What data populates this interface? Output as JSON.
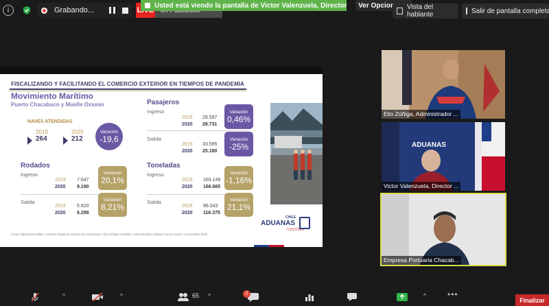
{
  "topbar": {
    "info_icon": "info-icon",
    "shield_icon": "shield-icon",
    "recording_label": "Grabando...",
    "live_label": "LIVE",
    "facebook_label": "en Facebook",
    "banner_text": "Usted está viendo la pantalla de Victor Valenzuela, Director Ad...",
    "view_options_label": "Ver Opciones",
    "speaker_view_label": "Vista del hablante",
    "exit_fullscreen_label": "Salir de pantalla completa"
  },
  "slide": {
    "title": "FISCALIZANDO Y FACILITANDO EL COMERCIO EXTERIOR EN TIEMPOS DE PANDEMIA",
    "main_heading": "Movimiento Marítimo",
    "sub_heading": "Puerto Chacabuco y Muelle Oxxean",
    "naves": {
      "label": "NAVES ATENDIDAS",
      "year_a": "2019",
      "value_a": "264",
      "year_b": "2020",
      "value_b": "212",
      "var_label": "Variación",
      "var_value": "-19,6"
    },
    "pasajeros": {
      "title": "Pasajeros",
      "ingreso": {
        "label": "Ingreso",
        "y2019": "2019",
        "v2019": "28.597",
        "y2020": "2020",
        "v2020": "28.731",
        "var_label": "Variación",
        "var_value": "0,46%"
      },
      "salida": {
        "label": "Salida",
        "y2019": "2019",
        "v2019": "33.595",
        "y2020": "2020",
        "v2020": "25.180",
        "var_label": "Variación",
        "var_value": "-25%"
      }
    },
    "rodados": {
      "title": "Rodados",
      "ingreso": {
        "label": "Ingreso",
        "y2019": "2019",
        "v2019": "7.647",
        "y2020": "2020",
        "v2020": "9.190",
        "var_label": "Variación",
        "var_value": "20,1%"
      },
      "salida": {
        "label": "Salida",
        "y2019": "2019",
        "v2019": "5.820",
        "y2020": "2020",
        "v2020": "6.298",
        "var_label": "Variación",
        "var_value": "8,21%"
      }
    },
    "toneladas": {
      "title": "Toneladas",
      "ingreso": {
        "label": "Ingreso",
        "y2019": "2019",
        "v2019": "169.149",
        "y2020": "2020",
        "v2020": "166.665",
        "var_label": "Variación",
        "var_value": "-1,16%"
      },
      "salida": {
        "label": "Salida",
        "y2019": "2019",
        "v2019": "96.043",
        "y2020": "2020",
        "v2020": "116.375",
        "var_label": "Variación",
        "var_value": "21,1%"
      }
    },
    "footnote": "Víctor Valenzuela Millán, Director Regional Aduana de Coyhaique / Elio Zúñiga Astudillo, Administrador Aduana Puerto Aysén / Noviembre 2020",
    "logo": {
      "chile": "CHILE",
      "name": "ADUANAS",
      "customs": "CUSTOMS"
    }
  },
  "participants": [
    {
      "name": "Elio Zúñiga, Administrador ..."
    },
    {
      "name": "Victor Valenzuela, Director ..."
    },
    {
      "name": "Empresa Portuaria Chacab..."
    }
  ],
  "bottombar": {
    "participants_count": "65",
    "chat_badge": "2",
    "finalizar_label": "Finalizar"
  },
  "colors": {
    "accent_purple": "#6b58a4",
    "accent_gold": "#b5a269",
    "live_red": "#e5251f",
    "banner_green": "#5fb34a",
    "end_red": "#c62828"
  }
}
